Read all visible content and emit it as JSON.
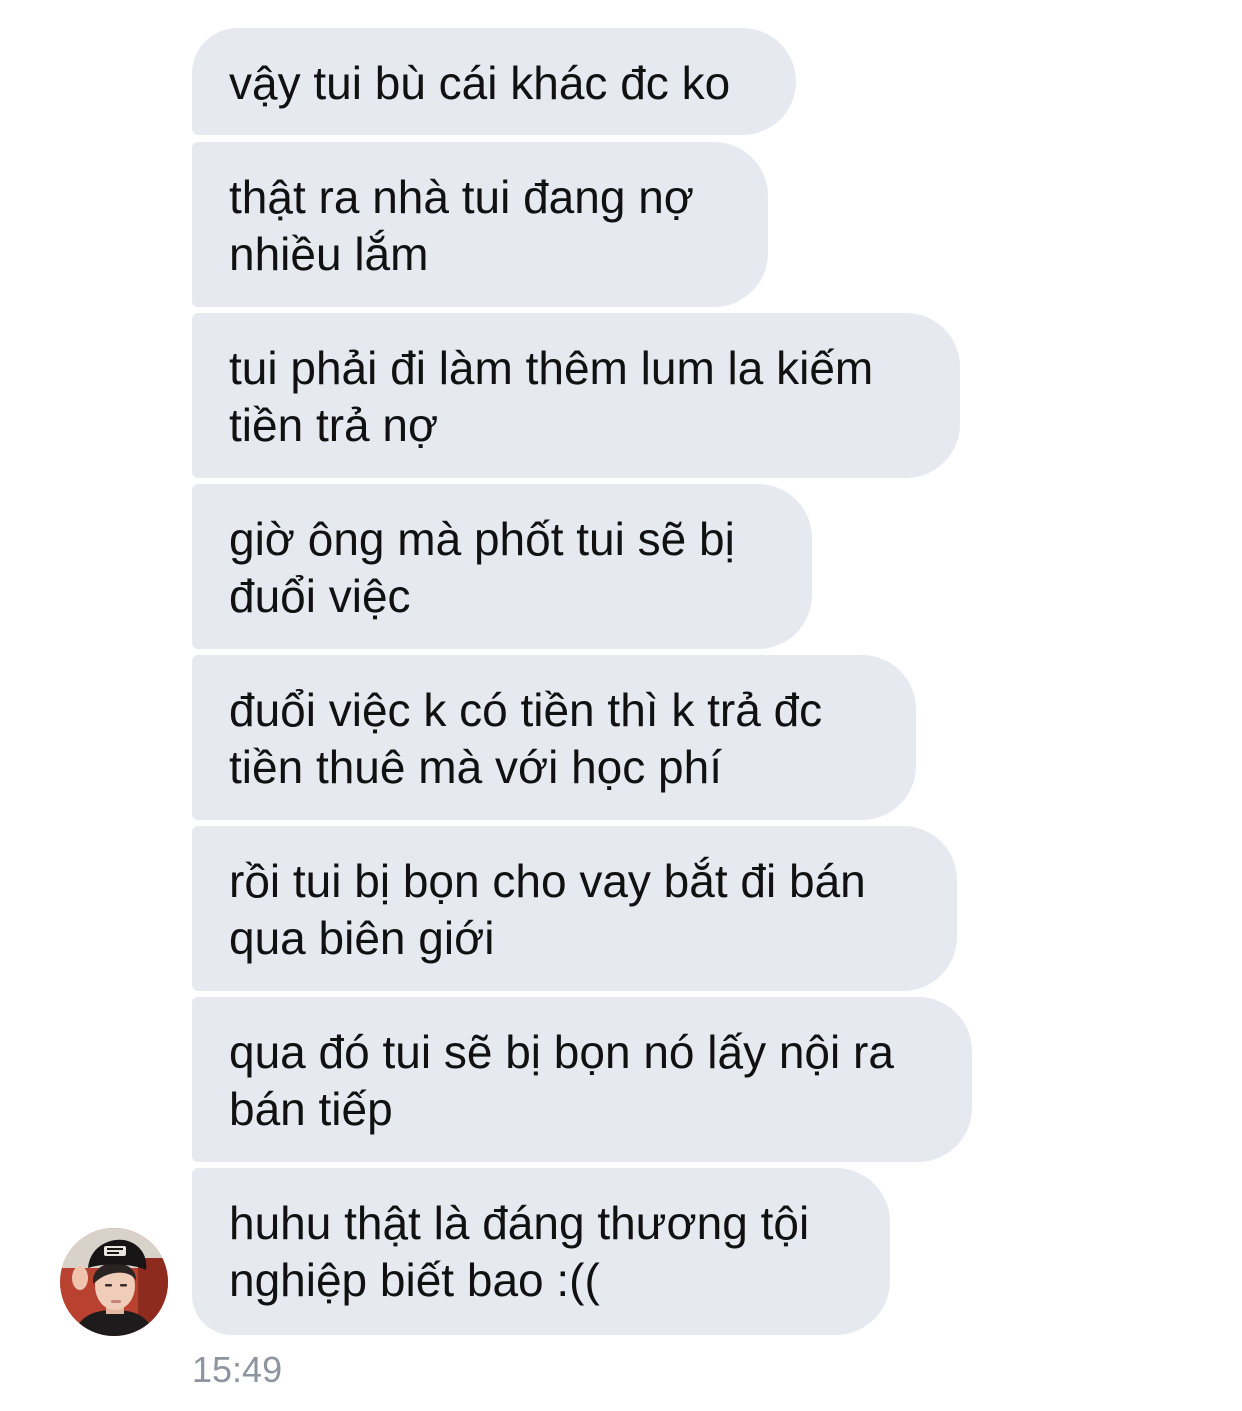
{
  "conversation": {
    "messages": [
      {
        "text": "vậy tui bù cái khác đc ko"
      },
      {
        "text": "thật ra nhà tui đang nợ\nnhiều lắm"
      },
      {
        "text": "tui phải đi làm thêm lum la kiếm\ntiền trả nợ"
      },
      {
        "text": "giờ ông mà phốt tui sẽ bị\nđuổi việc"
      },
      {
        "text": "đuổi việc k có tiền thì k trả đc\ntiền thuê mà với học phí"
      },
      {
        "text": "rồi tui bị bọn cho vay bắt đi bán\nqua biên giới"
      },
      {
        "text": "qua đó tui sẽ bị bọn nó lấy nội ra\nbán tiếp"
      },
      {
        "text": "huhu thật là đáng thương tội\nnghiệp biết bao :(("
      }
    ],
    "timestamp": "15:49",
    "sender_avatar_icon": "user-photo-avatar",
    "bubble_color": "#e6e9f0",
    "timestamp_color": "#8e94a0"
  }
}
